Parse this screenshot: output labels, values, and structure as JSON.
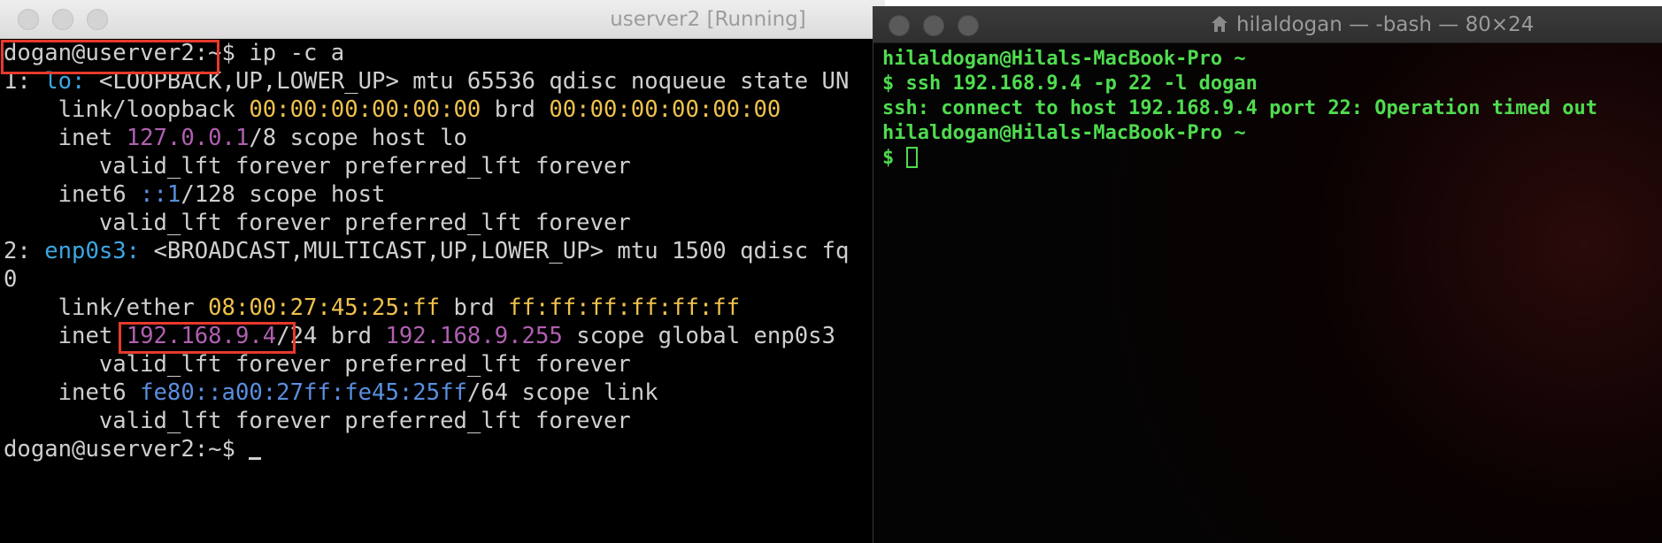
{
  "vm": {
    "title": "userver2 [Running]",
    "lines": [
      {
        "segments": [
          {
            "t": "dogan@userver2:~$ ip -c a",
            "c": ""
          }
        ]
      },
      {
        "segments": [
          {
            "t": "1: ",
            "c": ""
          },
          {
            "t": "lo:",
            "c": "cyan"
          },
          {
            "t": " <LOOPBACK,UP,LOWER_UP> mtu 65536 qdisc noqueue state UN",
            "c": ""
          }
        ]
      },
      {
        "segments": [
          {
            "t": "    link/loopback ",
            "c": ""
          },
          {
            "t": "00:00:00:00:00:00",
            "c": "yellow"
          },
          {
            "t": " brd ",
            "c": ""
          },
          {
            "t": "00:00:00:00:00:00",
            "c": "yellow"
          }
        ]
      },
      {
        "segments": [
          {
            "t": "    inet ",
            "c": ""
          },
          {
            "t": "127.0.0.1",
            "c": "purple"
          },
          {
            "t": "/8 scope host lo",
            "c": ""
          }
        ]
      },
      {
        "segments": [
          {
            "t": "       valid_lft forever preferred_lft forever",
            "c": ""
          }
        ]
      },
      {
        "segments": [
          {
            "t": "    inet6 ",
            "c": ""
          },
          {
            "t": "::1",
            "c": "blue"
          },
          {
            "t": "/128 scope host",
            "c": ""
          }
        ]
      },
      {
        "segments": [
          {
            "t": "       valid_lft forever preferred_lft forever",
            "c": ""
          }
        ]
      },
      {
        "segments": [
          {
            "t": "2: ",
            "c": ""
          },
          {
            "t": "enp0s3:",
            "c": "cyan"
          },
          {
            "t": " <BROADCAST,MULTICAST,UP,LOWER_UP> mtu 1500 qdisc fq",
            "c": ""
          }
        ]
      },
      {
        "segments": [
          {
            "t": "0",
            "c": ""
          }
        ]
      },
      {
        "segments": [
          {
            "t": "    link/ether ",
            "c": ""
          },
          {
            "t": "08:00:27:45:25:ff",
            "c": "yellow"
          },
          {
            "t": " brd ",
            "c": ""
          },
          {
            "t": "ff:ff:ff:ff:ff:ff",
            "c": "yellow"
          }
        ]
      },
      {
        "segments": [
          {
            "t": "    inet ",
            "c": ""
          },
          {
            "t": "192.168.9.4",
            "c": "purple"
          },
          {
            "t": "/24 brd ",
            "c": ""
          },
          {
            "t": "192.168.9.255",
            "c": "purple"
          },
          {
            "t": " scope global enp0s3",
            "c": ""
          }
        ]
      },
      {
        "segments": [
          {
            "t": "       valid_lft forever preferred_lft forever",
            "c": ""
          }
        ]
      },
      {
        "segments": [
          {
            "t": "    inet6 ",
            "c": ""
          },
          {
            "t": "fe80::a00:27ff:fe45:25ff",
            "c": "blue"
          },
          {
            "t": "/64 scope link",
            "c": ""
          }
        ]
      },
      {
        "segments": [
          {
            "t": "       valid_lft forever preferred_lft forever",
            "c": ""
          }
        ]
      },
      {
        "segments": [
          {
            "t": "dogan@userver2:~$ ",
            "c": ""
          }
        ]
      }
    ]
  },
  "mac": {
    "title": "hilaldogan — -bash — 80×24",
    "lines": [
      "hilaldogan@Hilals-MacBook-Pro ~",
      "$ ssh 192.168.9.4 -p 22 -l dogan",
      "ssh: connect to host 192.168.9.4 port 22: Operation timed out",
      "hilaldogan@Hilals-MacBook-Pro ~",
      "$ "
    ]
  },
  "colors": {
    "highlight": "#e8392a",
    "mac_green": "#4fdc4f",
    "vm_text": "#cfcfcf"
  }
}
